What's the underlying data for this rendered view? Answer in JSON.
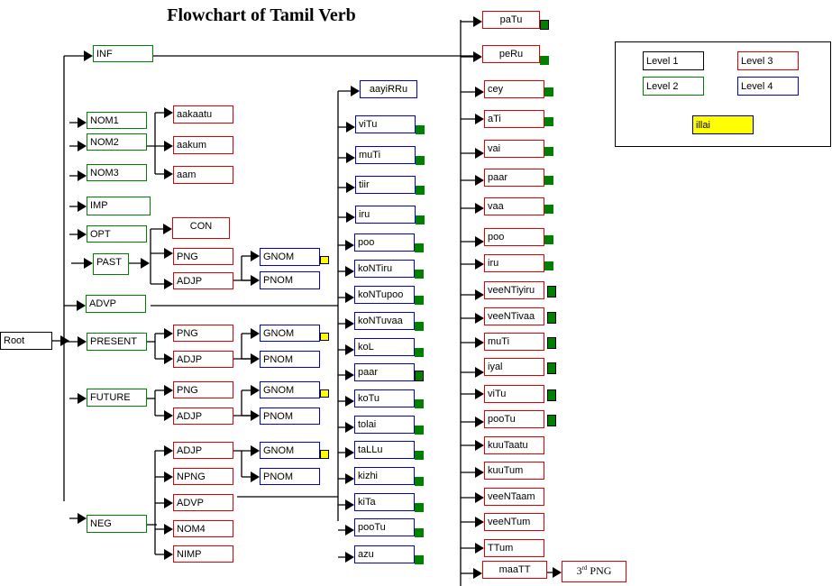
{
  "title": "Flowchart of Tamil Verb",
  "colors": {
    "level1": "#000000",
    "level2": "#008000",
    "level3": "#e00000",
    "level4": "#0000d0",
    "illai": "#ffff00",
    "marker": "#008000"
  },
  "root": {
    "label": "Root"
  },
  "level2": [
    {
      "id": "inf",
      "label": "INF"
    },
    {
      "id": "nom1",
      "label": "NOM1"
    },
    {
      "id": "nom2",
      "label": "NOM2"
    },
    {
      "id": "nom3",
      "label": "NOM3"
    },
    {
      "id": "imp",
      "label": "IMP"
    },
    {
      "id": "opt",
      "label": "OPT"
    },
    {
      "id": "past",
      "label": "PAST"
    },
    {
      "id": "advp",
      "label": "ADVP"
    },
    {
      "id": "present",
      "label": "PRESENT"
    },
    {
      "id": "future",
      "label": "FUTURE"
    },
    {
      "id": "neg",
      "label": "NEG"
    }
  ],
  "nominal_suffixes": [
    {
      "label": "aakaatu"
    },
    {
      "label": "aakum"
    },
    {
      "label": "aam"
    }
  ],
  "past_branch": {
    "con": "CON",
    "png": "PNG",
    "adjp": "ADJP",
    "gnom": "GNOM",
    "pnom": "PNOM"
  },
  "present_branch": {
    "png": "PNG",
    "adjp": "ADJP",
    "gnom": "GNOM",
    "pnom": "PNOM"
  },
  "future_branch": {
    "png": "PNG",
    "adjp": "ADJP",
    "gnom": "GNOM",
    "pnom": "PNOM"
  },
  "neg_branch": {
    "adjp": "ADJP",
    "npng": "NPNG",
    "advp": "ADVP",
    "nom4": "NOM4",
    "nimp": "NIMP",
    "gnom": "GNOM",
    "pnom": "PNOM"
  },
  "aux_column": [
    {
      "label": "aayiRRu",
      "marker": false
    },
    {
      "label": "viTu",
      "marker": true
    },
    {
      "label": "muTi",
      "marker": true
    },
    {
      "label": "tiir",
      "marker": true
    },
    {
      "label": "iru",
      "marker": true
    },
    {
      "label": "poo",
      "marker": true
    },
    {
      "label": "koNTiru",
      "marker": true
    },
    {
      "label": "koNTupoo",
      "marker": true
    },
    {
      "label": "koNTuvaa",
      "marker": true
    },
    {
      "label": "koL",
      "marker": true
    },
    {
      "label": "paar",
      "marker": true
    },
    {
      "label": "koTu",
      "marker": true
    },
    {
      "label": "tolai",
      "marker": true
    },
    {
      "label": "taLLu",
      "marker": true
    },
    {
      "label": "kizhi",
      "marker": true
    },
    {
      "label": "kiTa",
      "marker": true
    },
    {
      "label": "pooTu",
      "marker": true
    },
    {
      "label": "azu",
      "marker": true
    }
  ],
  "inf_column": [
    {
      "label": "paTu",
      "marker": true
    },
    {
      "label": "peRu",
      "marker": true
    },
    {
      "label": "cey",
      "marker": true
    },
    {
      "label": "aTi",
      "marker": true
    },
    {
      "label": "vai",
      "marker": true
    },
    {
      "label": "paar",
      "marker": true
    },
    {
      "label": "vaa",
      "marker": true
    },
    {
      "label": "poo",
      "marker": true
    },
    {
      "label": "iru",
      "marker": true
    },
    {
      "label": "veeNTiyiru",
      "marker": true
    },
    {
      "label": "veeNTivaa",
      "marker": true
    },
    {
      "label": "muTi",
      "marker": true
    },
    {
      "label": "iyal",
      "marker": true
    },
    {
      "label": "viTu",
      "marker": true
    },
    {
      "label": "pooTu",
      "marker": true
    },
    {
      "label": "kuuTaatu",
      "marker": false
    },
    {
      "label": "kuuTum",
      "marker": false
    },
    {
      "label": "veeNTaam",
      "marker": false
    },
    {
      "label": "veeNTum",
      "marker": false
    },
    {
      "label": "TTum",
      "marker": false
    },
    {
      "label": "maaTT",
      "marker": false
    }
  ],
  "maaTT_next": {
    "label": "3rd PNG",
    "base": "3",
    "sup": "rd",
    "rest": " PNG"
  },
  "legend": {
    "level1": "Level 1",
    "level2": "Level 2",
    "level3": "Level 3",
    "level4": "Level 4",
    "illai": "illai"
  }
}
